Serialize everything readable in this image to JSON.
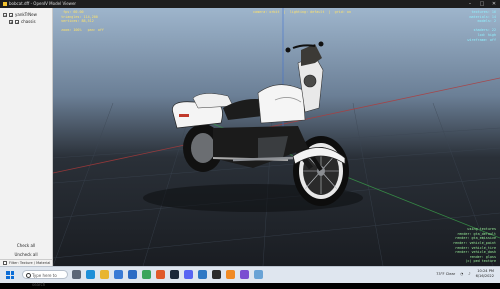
{
  "window": {
    "title": "bobcat.dff - OpenIV Model Viewer",
    "buttons": {
      "minimize": "–",
      "maximize": "□",
      "close": "✕"
    }
  },
  "sidebar": {
    "tree": [
      {
        "label": "yankTrNew",
        "checked": true,
        "expanded": true
      },
      {
        "label": "chassis",
        "checked": true,
        "expanded": false
      }
    ],
    "check_all": "Check all",
    "uncheck_all": "Uncheck all",
    "filter_label": "Filter: Texture / Material"
  },
  "hud": {
    "top_left": "   fps: 60.00\n  triangles: 114,200\n  vertices: 88,512\n\n  zoom: 100%   pan: off",
    "top_center": "camera: orbit  |  lighting: default  |  grid: on",
    "top_right": "  textures: 16\n  materials: 14\n  models: 2\n\n  shaders: 22\n  lod: high\n  wireframe: off",
    "bottom_right": "using textures\nrender: gta_default\nrender: gta_emissive\nrender: vehicle_paint\nrender: vehicle_tire\nrender: vehicle_dash\nrender: glass\n(c) ped texture"
  },
  "taskbar": {
    "search_placeholder": "Type here to search",
    "weather": "73°F  Clear",
    "time": "10:24 PM",
    "date": "6/16/2022",
    "icons": [
      "task-view-icon",
      "edge-icon",
      "file-explorer-icon",
      "store-icon",
      "mail-icon",
      "chrome-icon",
      "firefox-icon",
      "steam-icon",
      "discord-icon",
      "photoshop-icon",
      "terminal-icon",
      "openiv-icon",
      "media-player-icon",
      "notepad-icon"
    ]
  },
  "colors": {
    "hud_yellow": "#ffe36a",
    "hud_cyan": "#8ff0ff",
    "hud_green": "#9bf09b",
    "accent_blue": "#0a6cd6"
  }
}
